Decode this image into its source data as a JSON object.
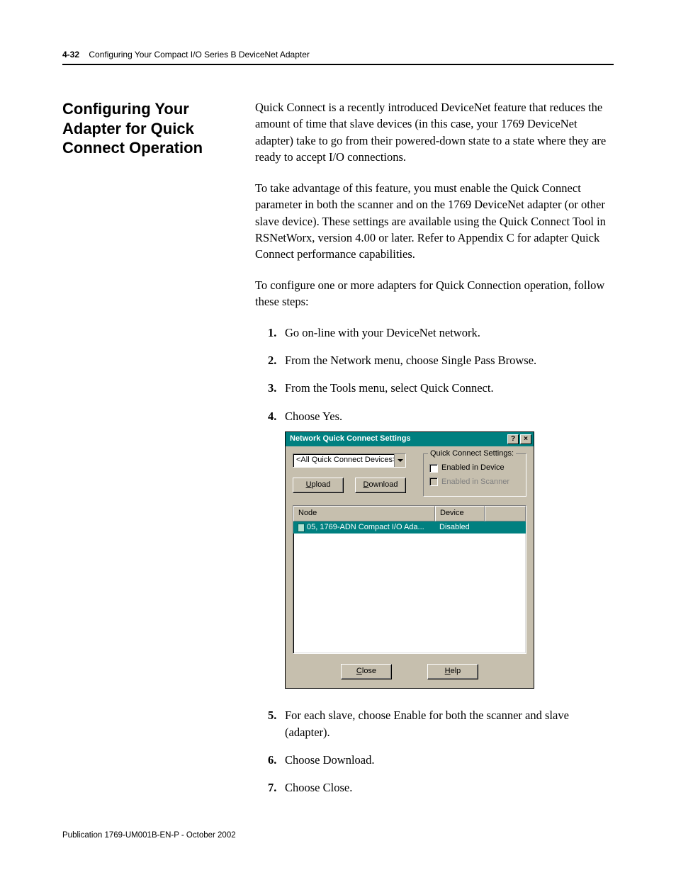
{
  "header": {
    "page_ref": "4-32",
    "title": "Configuring Your Compact I/O Series B DeviceNet Adapter"
  },
  "sidebar": {
    "heading": "Configuring Your Adapter for Quick Connect Operation"
  },
  "body": {
    "p1": "Quick Connect is a recently introduced DeviceNet feature that reduces the amount of time that slave devices (in this case, your 1769 DeviceNet adapter) take to go from their powered-down state to a state where they are ready to accept I/O connections.",
    "p2": "To take advantage of this feature, you must enable the Quick Connect parameter in both the scanner and on the 1769 DeviceNet adapter (or other slave device). These settings are available using the Quick Connect Tool in RSNetWorx, version 4.00 or later. Refer to Appendix C for adapter Quick Connect performance capabilities.",
    "p3": "To configure one or more adapters for Quick Connection operation, follow these steps:",
    "steps": {
      "s1": "Go on-line with your DeviceNet network.",
      "s2": "From the Network menu, choose Single Pass Browse.",
      "s3": "From the Tools menu, select Quick Connect.",
      "s4": "Choose Yes.",
      "s5": "For each slave, choose Enable for both the scanner and slave (adapter).",
      "s6": "Choose Download.",
      "s7": "Choose Close."
    }
  },
  "dialog": {
    "title": "Network Quick Connect Settings",
    "combo_value": "<All Quick Connect Devices>",
    "upload_u": "U",
    "upload_rest": "pload",
    "download_u": "D",
    "download_rest": "ownload",
    "fieldset_legend": "Quick Connect Settings:",
    "chk1_pre": "Enabled in De",
    "chk1_u": "v",
    "chk1_post": "ice",
    "chk2_pre": "Enabled in ",
    "chk2_u": "S",
    "chk2_post": "canner",
    "col_node": "Node",
    "col_device": "Device",
    "row_node": "05, 1769-ADN Compact I/O Ada...",
    "row_device": "Disabled",
    "close_u": "C",
    "close_rest": "lose",
    "help_u": "H",
    "help_rest": "elp"
  },
  "footer": {
    "text": "Publication 1769-UM001B-EN-P - October 2002"
  }
}
